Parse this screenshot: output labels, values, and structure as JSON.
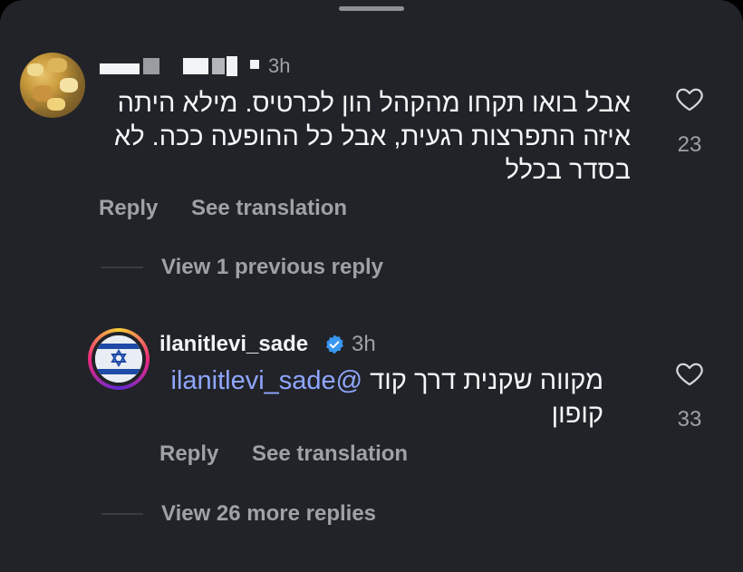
{
  "comment1": {
    "time": "3h",
    "text_line1": "אבל בואו תקחו מהקהל הון לכרטיס. מילא היתה",
    "text_line2": "איזה התפרצות רגעית, אבל כל ההופעה ככה. לא",
    "text_line3": "בסדר בכלל",
    "likes": "23",
    "reply_label": "Reply",
    "translate_label": "See translation"
  },
  "view_previous": "View 1 previous reply",
  "comment2": {
    "username": "ilanitlevi_sade",
    "time": "3h",
    "text_line1_prefix": "מקווה שקנית דרך קוד ",
    "mention": "@ilanitlevi_sade",
    "text_line2": "קופון",
    "likes": "33",
    "reply_label": "Reply",
    "translate_label": "See translation"
  },
  "view_more": "View 26 more replies",
  "icons": {
    "like": "heart-outline-icon",
    "verified": "verified-badge-icon"
  },
  "colors": {
    "background": "#212328",
    "secondary_text": "#9ea1a7",
    "mention": "#8fa6ff",
    "verified": "#3897f0"
  }
}
